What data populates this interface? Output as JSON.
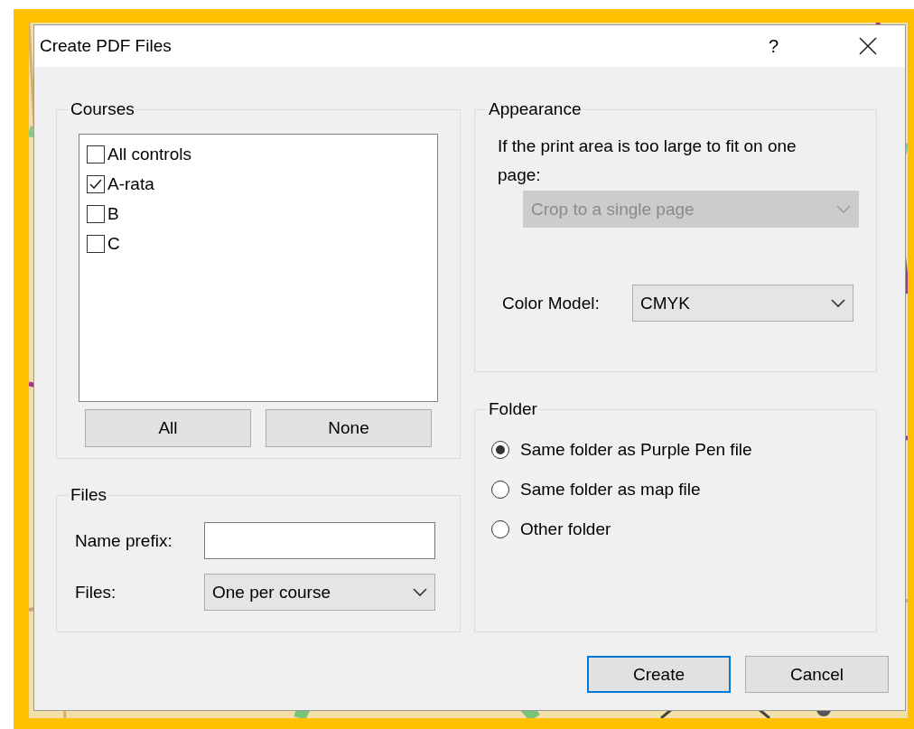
{
  "window": {
    "title": "Create PDF Files",
    "help": "?"
  },
  "courses": {
    "title": "Courses",
    "items": [
      {
        "label": "All controls",
        "checked": false
      },
      {
        "label": "A-rata",
        "checked": true
      },
      {
        "label": "B",
        "checked": false
      },
      {
        "label": "C",
        "checked": false
      }
    ],
    "buttons": [
      "All",
      "None"
    ]
  },
  "files": {
    "title": "Files",
    "name_prefix": {
      "label": "Name prefix:"
    },
    "files": {
      "label": "Files:",
      "value": "One per course"
    }
  },
  "appearance": {
    "title": "Appearance",
    "message": "If the print area is too large to fit on one page:",
    "crop": {
      "value": "Crop to a single page",
      "disabled": true
    },
    "color_model": {
      "label": "Color Model:",
      "value": "CMYK",
      "disabled": false
    }
  },
  "folder": {
    "title": "Folder",
    "options": [
      {
        "label": "Same folder as Purple Pen file",
        "selected": true
      },
      {
        "label": "Same folder as map file",
        "selected": false
      },
      {
        "label": "Other folder",
        "selected": false
      }
    ]
  },
  "buttons": [
    {
      "label": "Create",
      "default": true
    },
    {
      "label": "Cancel",
      "default": false
    }
  ]
}
